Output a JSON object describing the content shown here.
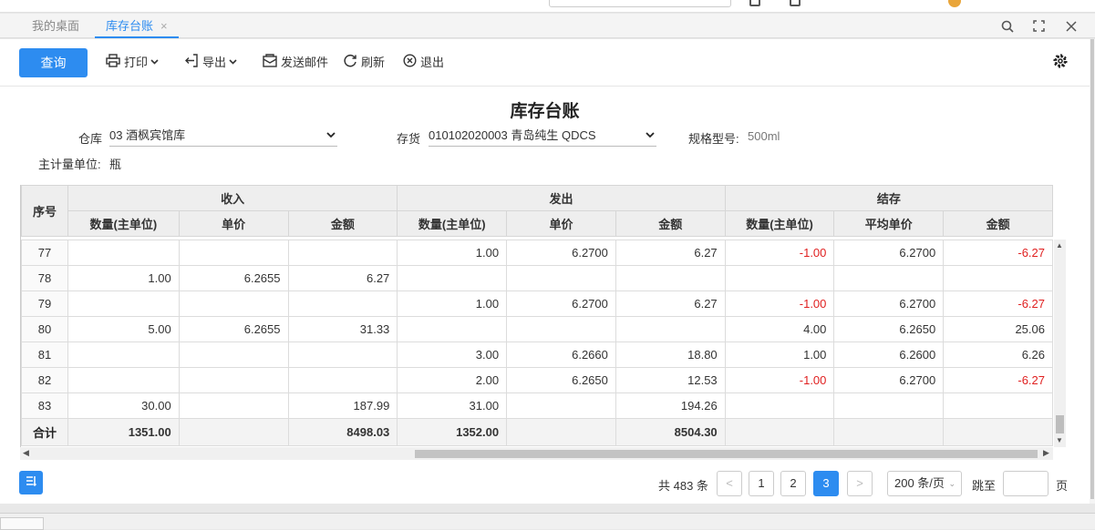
{
  "tabs": [
    {
      "label": "我的桌面"
    },
    {
      "label": "库存台账",
      "close": "×"
    }
  ],
  "toolbar": {
    "query": "查询",
    "print": "打印",
    "export": "导出",
    "send_mail": "发送邮件",
    "refresh": "刷新",
    "exit": "退出"
  },
  "report": {
    "title": "库存台账",
    "warehouse_label": "仓库",
    "warehouse_value": "03 酒枫宾馆库",
    "inventory_label": "存货",
    "inventory_value": "010102020003 青岛纯生 QDCS",
    "spec_label": "规格型号:",
    "spec_value": "500ml",
    "unit_label": "主计量单位:",
    "unit_value": "瓶"
  },
  "table": {
    "col_seq": "序号",
    "groups": [
      "收入",
      "发出",
      "结存"
    ],
    "sub_headers": [
      "数量(主单位)",
      "单价",
      "金额",
      "数量(主单位)",
      "单价",
      "金额",
      "数量(主单位)",
      "平均单价",
      "金额"
    ],
    "rows": [
      {
        "seq": "77",
        "cells": [
          "",
          "",
          "",
          "1.00",
          "6.2700",
          "6.27",
          "-1.00",
          "6.2700",
          "-6.27"
        ],
        "neg": [
          6,
          8
        ]
      },
      {
        "seq": "78",
        "cells": [
          "1.00",
          "6.2655",
          "6.27",
          "",
          "",
          "",
          "",
          "",
          ""
        ],
        "neg": []
      },
      {
        "seq": "79",
        "cells": [
          "",
          "",
          "",
          "1.00",
          "6.2700",
          "6.27",
          "-1.00",
          "6.2700",
          "-6.27"
        ],
        "neg": [
          6,
          8
        ]
      },
      {
        "seq": "80",
        "cells": [
          "5.00",
          "6.2655",
          "31.33",
          "",
          "",
          "",
          "4.00",
          "6.2650",
          "25.06"
        ],
        "neg": []
      },
      {
        "seq": "81",
        "cells": [
          "",
          "",
          "",
          "3.00",
          "6.2660",
          "18.80",
          "1.00",
          "6.2600",
          "6.26"
        ],
        "neg": []
      },
      {
        "seq": "82",
        "cells": [
          "",
          "",
          "",
          "2.00",
          "6.2650",
          "12.53",
          "-1.00",
          "6.2700",
          "-6.27"
        ],
        "neg": [
          6,
          8
        ]
      },
      {
        "seq": "83",
        "cells": [
          "30.00",
          "",
          "187.99",
          "31.00",
          "",
          "194.26",
          "",
          "",
          ""
        ],
        "neg": []
      }
    ],
    "total": {
      "seq": "合计",
      "cells": [
        "1351.00",
        "",
        "8498.03",
        "1352.00",
        "",
        "8504.30",
        "",
        "",
        ""
      ]
    }
  },
  "pager": {
    "total_text": "共 483 条",
    "prev": "<",
    "pages": [
      "1",
      "2",
      "3"
    ],
    "current": "3",
    "next": ">",
    "page_size": "200 条/页",
    "jump_label": "跳至",
    "page_unit": "页"
  },
  "colors": {
    "accent": "#2d8cf0",
    "negative": "#e02020"
  }
}
